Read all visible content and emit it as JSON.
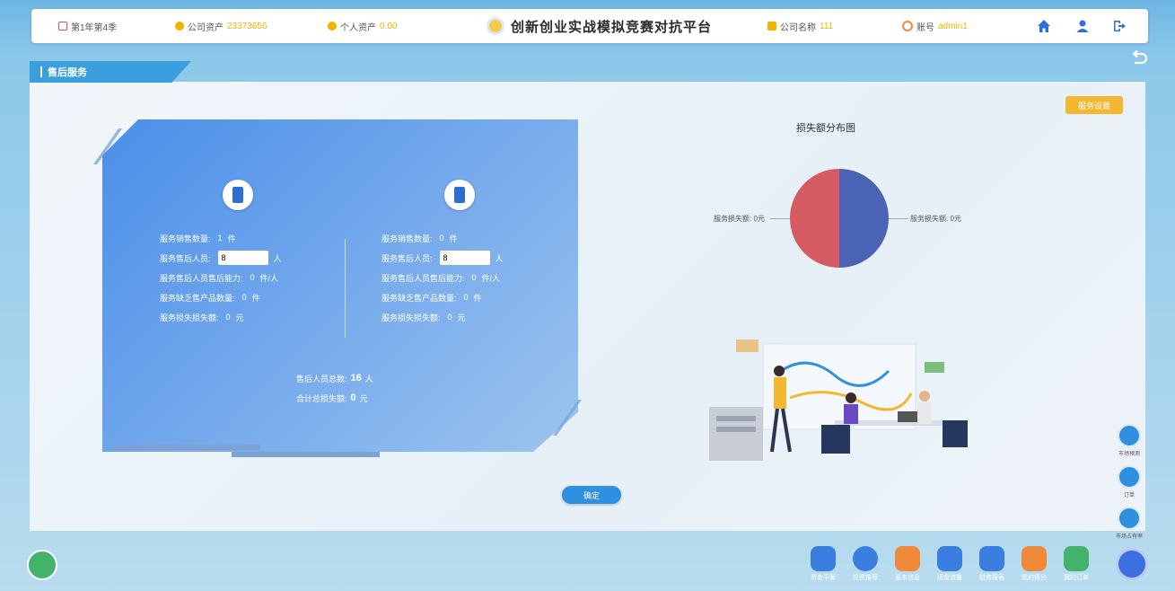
{
  "topbar": {
    "round": "第1年第4季",
    "company_assets_label": "公司资产",
    "company_assets_value": "23373656",
    "personal_assets_label": "个人资产",
    "personal_assets_value": "0.00",
    "title": "创新创业实战模拟竞赛对抗平台",
    "company_name_label": "公司名称",
    "company_name_value": "111",
    "account_label": "账号",
    "account_value": "admin1"
  },
  "section_tab": "售后服务",
  "settings_button": "服务设置",
  "left_col": {
    "rows": [
      {
        "label": "服务销售数量:",
        "value": "1",
        "unit": "件"
      },
      {
        "label": "服务售后人员:",
        "input_value": "8",
        "unit": "人"
      },
      {
        "label": "服务售后人员售后能力:",
        "value": "0",
        "unit": "件/人"
      },
      {
        "label": "服务缺乏售产品数量:",
        "value": "0",
        "unit": "件"
      },
      {
        "label": "服务损失损失额:",
        "value": "0",
        "unit": "元"
      }
    ]
  },
  "right_col": {
    "rows": [
      {
        "label": "服务销售数量:",
        "value": "0",
        "unit": "件"
      },
      {
        "label": "服务售后人员:",
        "input_value": "8",
        "unit": "人"
      },
      {
        "label": "服务售后人员售后能力:",
        "value": "0",
        "unit": "件/人"
      },
      {
        "label": "服务缺乏售产品数量:",
        "value": "0",
        "unit": "件"
      },
      {
        "label": "服务损失损失额:",
        "value": "0",
        "unit": "元"
      }
    ]
  },
  "summary": {
    "staff_label": "售后人员总数:",
    "staff_value": "16",
    "staff_unit": "人",
    "loss_label": "合计总损失额:",
    "loss_value": "0",
    "loss_unit": "元"
  },
  "chart_data": {
    "type": "pie",
    "title": "损失额分布图",
    "slices": [
      {
        "name": "服务损失额",
        "label": "服务损失额: 0元",
        "value": 50,
        "color": "#4a63b5"
      },
      {
        "name": "服务损失额",
        "label": "服务损失额: 0元",
        "value": 50,
        "color": "#d65a62"
      }
    ]
  },
  "confirm_button": "确定",
  "side_buttons": [
    "市场预测",
    "订单",
    "市场占有率"
  ],
  "dock": [
    {
      "label": "资金平衡",
      "color": "#3a7fe0"
    },
    {
      "label": "投资推荐",
      "color": "#3a7fe0"
    },
    {
      "label": "基本信息",
      "color": "#f08a3a"
    },
    {
      "label": "现金流量",
      "color": "#3a7fe0"
    },
    {
      "label": "财务报表",
      "color": "#3a7fe0"
    },
    {
      "label": "我的得分",
      "color": "#f08a3a"
    },
    {
      "label": "我的订单",
      "color": "#43b36b"
    }
  ],
  "colors": {
    "accent": "#3b9fde",
    "warning": "#f4b731"
  }
}
